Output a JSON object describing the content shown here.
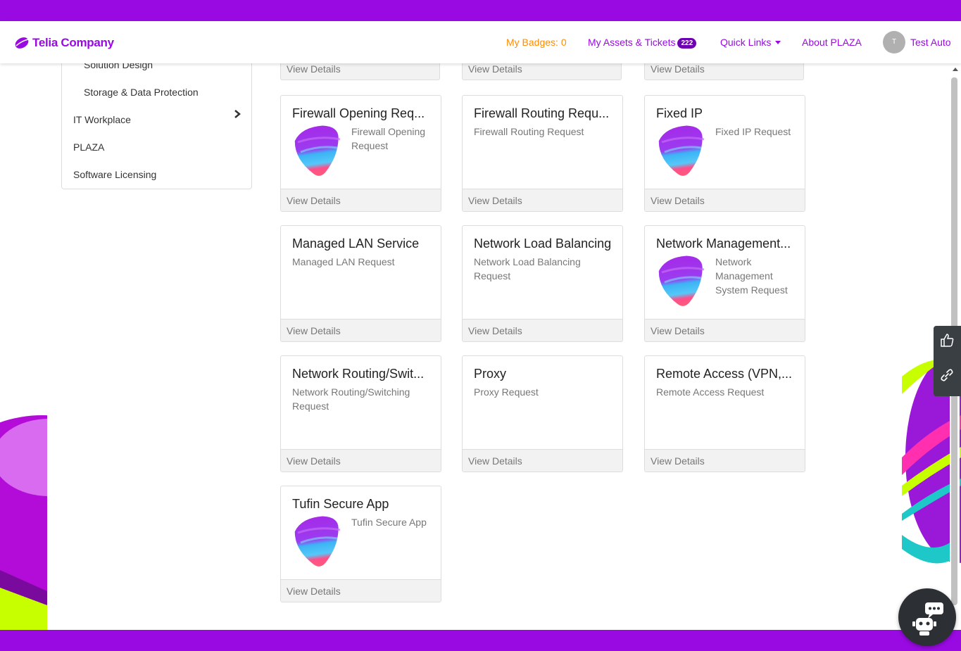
{
  "brand": {
    "name": "Telia Company",
    "color": "#990ae3"
  },
  "nav": {
    "badges": "My Badges: 0",
    "assets": "My Assets & Tickets",
    "assets_count": "222",
    "quick_links": "Quick Links",
    "about": "About PLAZA",
    "avatar_initial": "T",
    "user": "Test Auto"
  },
  "sidebar": {
    "items": [
      {
        "label": "Solution Design"
      },
      {
        "label": "Storage & Data Protection"
      },
      {
        "label": "IT Workplace"
      },
      {
        "label": "PLAZA"
      },
      {
        "label": "Software Licensing"
      }
    ]
  },
  "top_cards": [
    {
      "footer": "View Details"
    },
    {
      "footer": "View Details"
    },
    {
      "footer": "View Details"
    }
  ],
  "cards": [
    {
      "title": "Firewall Opening Req...",
      "desc": "Firewall Opening Request",
      "image": "telia-pebble-icon",
      "footer": "View Details"
    },
    {
      "title": "Firewall Routing Requ...",
      "desc": "Firewall Routing Request",
      "image": "",
      "footer": "View Details"
    },
    {
      "title": "Fixed IP",
      "desc": "Fixed IP Request",
      "image": "telia-pebble-icon",
      "footer": "View Details"
    },
    {
      "title": "Managed LAN Service",
      "desc": "Managed LAN Request",
      "image": "",
      "footer": "View Details"
    },
    {
      "title": "Network Load Balancing",
      "desc": "Network Load Balancing Request",
      "image": "",
      "footer": "View Details"
    },
    {
      "title": "Network Management...",
      "desc": "Network Management System Request",
      "image": "telia-pebble-icon",
      "footer": "View Details"
    },
    {
      "title": "Network Routing/Swit...",
      "desc": "Network Routing/Switching Request",
      "image": "",
      "footer": "View Details"
    },
    {
      "title": "Proxy",
      "desc": "Proxy Request",
      "image": "",
      "footer": "View Details"
    },
    {
      "title": "Remote Access (VPN,...",
      "desc": "Remote Access Request",
      "image": "",
      "footer": "View Details"
    },
    {
      "title": "Tufin Secure App",
      "desc": "Tufin Secure App",
      "image": "telia-pebble-icon",
      "footer": "View Details"
    }
  ],
  "tools": {
    "feedback_icon": "thumbs-up-icon",
    "link_icon": "link-icon",
    "chatbot_icon": "chatbot-icon"
  }
}
